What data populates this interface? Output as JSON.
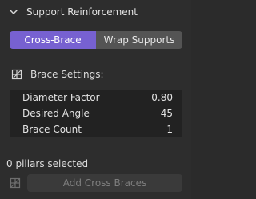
{
  "panel": {
    "title": "Support Reinforcement",
    "tabs": [
      {
        "label": "Cross-Brace",
        "active": true
      },
      {
        "label": "Wrap Supports",
        "active": false
      }
    ],
    "section_label": "Brace Settings:",
    "fields": [
      {
        "label": "Diameter Factor",
        "value": "0.80"
      },
      {
        "label": "Desired Angle",
        "value": "45"
      },
      {
        "label": "Brace Count",
        "value": "1"
      }
    ],
    "status": "0 pillars selected",
    "action_label": "Add Cross Braces"
  },
  "colors": {
    "accent": "#7761d1",
    "panel_bg": "#2d2d2d",
    "field_bg": "#222222",
    "disabled_text": "#7e7e7e"
  },
  "icons": {
    "collapse": "chevron-down-icon",
    "settings": "grid-icon",
    "action": "grid-icon"
  }
}
